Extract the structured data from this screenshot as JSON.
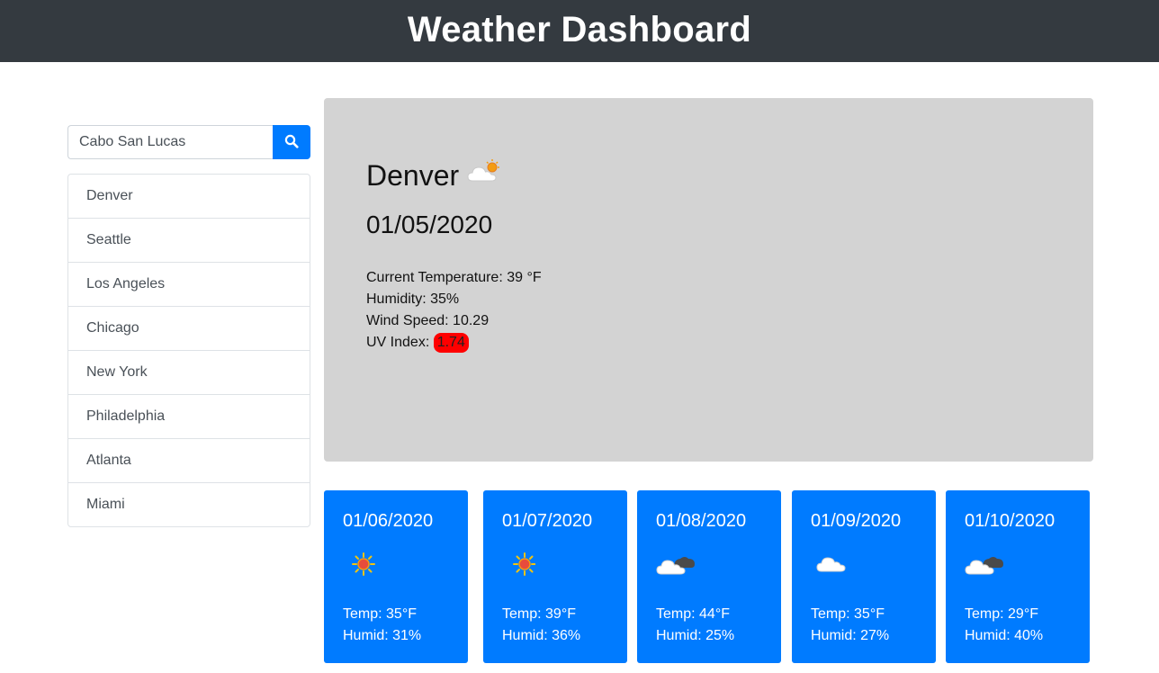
{
  "header": {
    "title": "Weather Dashboard"
  },
  "search": {
    "value": "Cabo San Lucas",
    "button_icon": "search-icon"
  },
  "cities": [
    "Denver",
    "Seattle",
    "Los Angeles",
    "Chicago",
    "New York",
    "Philadelphia",
    "Atlanta",
    "Miami"
  ],
  "current": {
    "city": "Denver",
    "icon": "partly-cloudy-icon",
    "date": "01/05/2020",
    "temperature": "Current Temperature: 39 °F",
    "humidity": "Humidity: 35%",
    "wind": "Wind Speed: 10.29",
    "uv_label": "UV Index: ",
    "uv_value": "1.74",
    "uv_color": "#ff0000"
  },
  "forecast": [
    {
      "date": "01/06/2020",
      "icon": "sun-icon",
      "temp": "Temp: 35°F",
      "humid": "Humid: 31%"
    },
    {
      "date": "01/07/2020",
      "icon": "sun-icon",
      "temp": "Temp: 39°F",
      "humid": "Humid: 36%"
    },
    {
      "date": "01/08/2020",
      "icon": "broken-clouds-icon",
      "temp": "Temp: 44°F",
      "humid": "Humid: 25%"
    },
    {
      "date": "01/09/2020",
      "icon": "cloud-icon",
      "temp": "Temp: 35°F",
      "humid": "Humid: 27%"
    },
    {
      "date": "01/10/2020",
      "icon": "broken-clouds-icon",
      "temp": "Temp: 29°F",
      "humid": "Humid: 40%"
    }
  ],
  "colors": {
    "header_bg": "#343a40",
    "accent": "#007bff",
    "current_bg": "#d3d3d3"
  }
}
